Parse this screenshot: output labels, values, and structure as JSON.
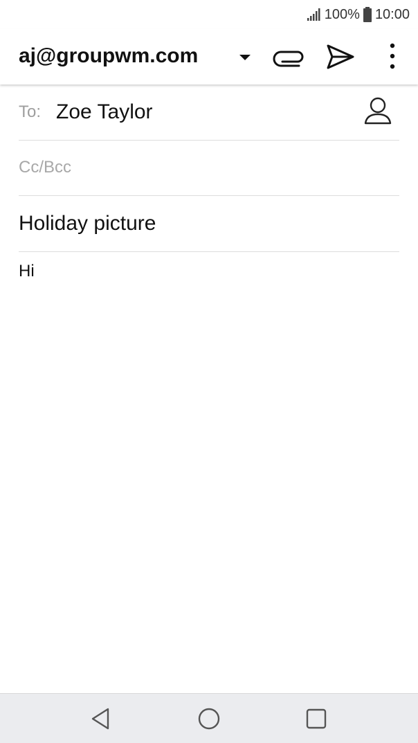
{
  "status_bar": {
    "battery": "100%",
    "time": "10:00"
  },
  "app_bar": {
    "account": "aj@groupwm.com"
  },
  "compose": {
    "to_label": "To:",
    "to_value": "Zoe Taylor",
    "cc_placeholder": "Cc/Bcc",
    "subject": "Holiday picture",
    "body": "Hi"
  },
  "colors": {
    "accent_text": "#111111",
    "hint_text": "#9e9e9e",
    "divider": "#dcdcdc",
    "nav_bg": "#ebecef"
  },
  "icons": {
    "signal": "signal-icon",
    "battery": "battery-icon",
    "dropdown": "chevron-down-icon",
    "attach": "paperclip-icon",
    "send": "send-icon",
    "more": "more-vert-icon",
    "contact": "person-icon",
    "back": "back-icon",
    "home": "home-icon",
    "recents": "recents-icon"
  }
}
